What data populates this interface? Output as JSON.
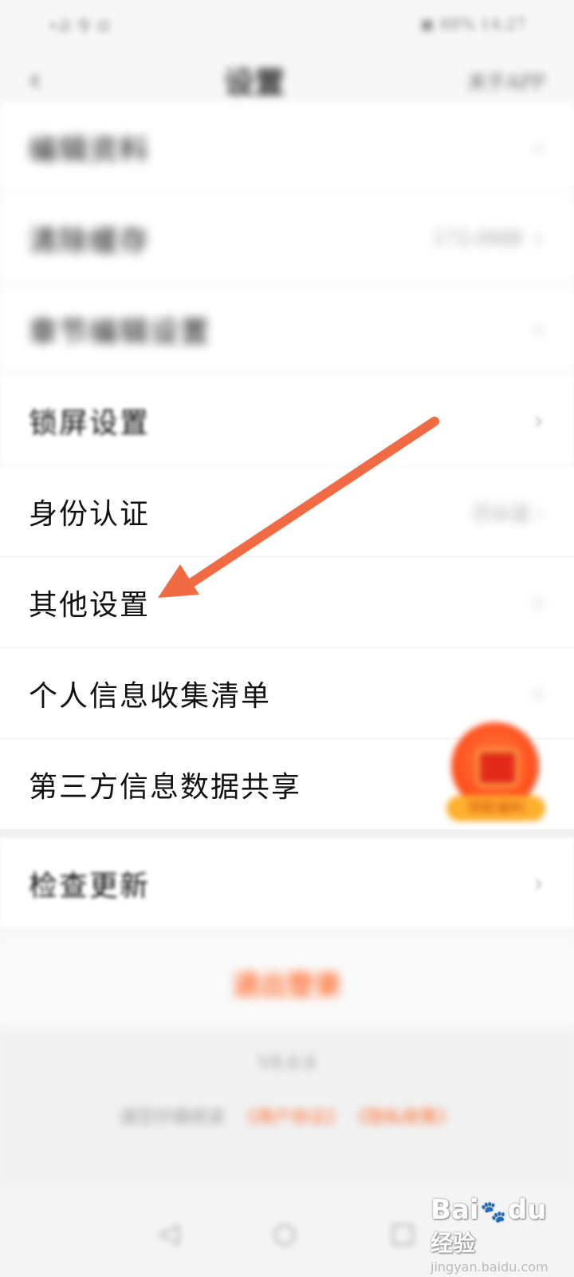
{
  "status_bar": {
    "left": "•ᵢll 令 ⊡",
    "right": "▣ 88% 14:27"
  },
  "nav": {
    "back_icon": "chevron-left-icon",
    "back_glyph": "‹",
    "title": "设置",
    "right": "关于APP"
  },
  "settings": {
    "rows": [
      {
        "label": "编辑资料",
        "value": "",
        "chevron": "›"
      },
      {
        "label": "清除缓存",
        "value": "172.0MB",
        "chevron": "›"
      },
      {
        "label": "章节编辑设置",
        "value": "",
        "chevron": "›"
      },
      {
        "label": "锁屏设置",
        "value": "",
        "chevron": "›"
      },
      {
        "label": "身份认证",
        "value": "已认证 ›",
        "chevron": ""
      },
      {
        "label": "其他设置",
        "value": "",
        "chevron": "›"
      },
      {
        "label": "个人信息收集清单",
        "value": "",
        "chevron": "›"
      },
      {
        "label": "第三方信息数据共享",
        "value": "",
        "chevron": ""
      },
      {
        "label": "检查更新",
        "value": "",
        "chevron": "›"
      }
    ],
    "logout": "退出登录"
  },
  "footer": {
    "version": "V8.8.8",
    "text": "请您仔细阅读",
    "link1": "《用户协议》",
    "link2": "《隐私政策》"
  },
  "system_nav": {
    "back": "◁",
    "home": "○",
    "recent": "□"
  },
  "float_badge": {
    "tag": "领取福利"
  },
  "watermark": {
    "brand_left": "Bai",
    "brand_right": "du",
    "paw": "🐾",
    "cn": "经验",
    "sub": "jingyan.baidu.com"
  },
  "colors": {
    "accent": "#ff6a2a",
    "arrow": "#f06a44"
  }
}
